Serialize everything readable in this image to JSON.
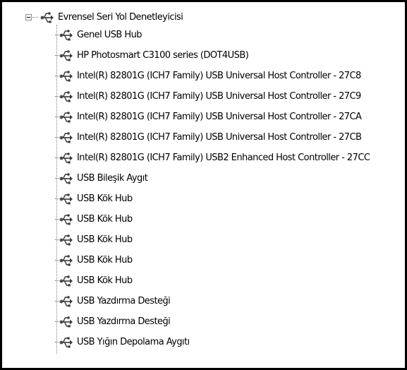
{
  "tree": {
    "root": {
      "label": "Evrensel Seri Yol Denetleyicisi",
      "icon": "usb-controller-icon",
      "expanded": true
    },
    "children": [
      {
        "label": "Genel USB Hub"
      },
      {
        "label": "HP Photosmart C3100 series (DOT4USB)"
      },
      {
        "label": "Intel(R) 82801G (ICH7 Family) USB Universal Host Controller - 27C8"
      },
      {
        "label": "Intel(R) 82801G (ICH7 Family) USB Universal Host Controller - 27C9"
      },
      {
        "label": "Intel(R) 82801G (ICH7 Family) USB Universal Host Controller - 27CA"
      },
      {
        "label": "Intel(R) 82801G (ICH7 Family) USB Universal Host Controller - 27CB"
      },
      {
        "label": "Intel(R) 82801G (ICH7 Family) USB2 Enhanced Host Controller - 27CC"
      },
      {
        "label": "USB Bileşik Aygıt"
      },
      {
        "label": "USB Kök Hub"
      },
      {
        "label": "USB Kök Hub"
      },
      {
        "label": "USB Kök Hub"
      },
      {
        "label": "USB Kök Hub"
      },
      {
        "label": "USB Kök Hub"
      },
      {
        "label": "USB Yazdırma Desteği"
      },
      {
        "label": "USB Yazdırma Desteği"
      },
      {
        "label": "USB Yığın Depolama Aygıtı"
      }
    ]
  },
  "colors": {
    "border": "#000000",
    "guide_lines": "#808080",
    "text": "#000000",
    "background": "#ffffff"
  }
}
